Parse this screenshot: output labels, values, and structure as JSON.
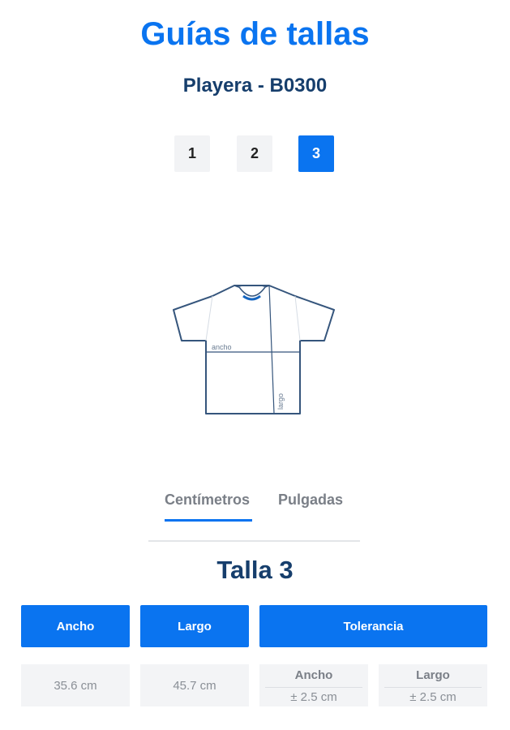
{
  "header": {
    "title": "Guías de tallas",
    "subtitle": "Playera - B0300"
  },
  "size_selector": {
    "sizes": [
      "1",
      "2",
      "3"
    ],
    "selected": "3"
  },
  "diagram": {
    "width_label": "ancho",
    "length_label": "largo"
  },
  "unit_tabs": {
    "tabs": [
      "Centímetros",
      "Pulgadas"
    ],
    "selected": "Centímetros"
  },
  "size_table": {
    "title": "Talla 3",
    "headers": [
      "Ancho",
      "Largo",
      "Tolerancia"
    ],
    "values": [
      "35.6 cm",
      "45.7 cm"
    ],
    "tolerance": [
      {
        "label": "Ancho",
        "value": "± 2.5 cm"
      },
      {
        "label": "Largo",
        "value": "± 2.5 cm"
      }
    ]
  },
  "colors": {
    "accent": "#0a74f0",
    "heading": "#163e6c",
    "muted_bg": "#f3f4f6"
  }
}
